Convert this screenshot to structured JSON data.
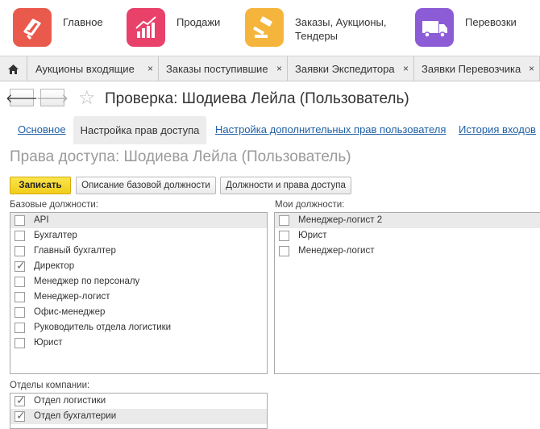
{
  "sections": [
    {
      "label": "Главное",
      "color": "#ea5a4c",
      "icon": "main-icon"
    },
    {
      "label": "Продажи",
      "color": "#e8416a",
      "icon": "sales-chart-icon"
    },
    {
      "label": "Заказы,  Аукционы, Тендеры",
      "color": "#f5b53c",
      "icon": "auction-gavel-icon"
    },
    {
      "label": "Перевозки",
      "color": "#8c5bd6",
      "icon": "truck-icon"
    }
  ],
  "tabs": [
    {
      "label": "Аукционы входящие"
    },
    {
      "label": "Заказы поступившие"
    },
    {
      "label": "Заявки Экспедитора"
    },
    {
      "label": "Заявки Перевозчика"
    }
  ],
  "close_glyph": "×",
  "nav": {
    "back": "🡐",
    "forward": "🡒"
  },
  "form": {
    "title": "Проверка: Шодиева Лейла (Пользователь)",
    "links": [
      {
        "label": "Основное"
      },
      {
        "label": "Настройка прав доступа"
      },
      {
        "label": "Настройка дополнительных прав пользователя"
      },
      {
        "label": "История входов"
      }
    ],
    "subtitle": "Права доступа: Шодиева Лейла (Пользователь)"
  },
  "buttons": {
    "save": "Записать",
    "base_description": "Описание базовой должности",
    "positions_rights": "Должности и права доступа"
  },
  "base_positions": {
    "caption": "Базовые должности:",
    "items": [
      {
        "label": "API",
        "checked": false,
        "selected": true
      },
      {
        "label": "Бухгалтер",
        "checked": false,
        "selected": false
      },
      {
        "label": "Главный бухгалтер",
        "checked": false,
        "selected": false
      },
      {
        "label": "Директор",
        "checked": true,
        "selected": false
      },
      {
        "label": "Менеджер по персоналу",
        "checked": false,
        "selected": false
      },
      {
        "label": "Менеджер-логист",
        "checked": false,
        "selected": false
      },
      {
        "label": "Офис-менеджер",
        "checked": false,
        "selected": false
      },
      {
        "label": "Руководитель отдела логистики",
        "checked": false,
        "selected": false
      },
      {
        "label": "Юрист",
        "checked": false,
        "selected": false
      }
    ]
  },
  "my_positions": {
    "caption": "Мои должности:",
    "items": [
      {
        "label": "Менеджер-логист 2",
        "checked": false,
        "selected": true
      },
      {
        "label": "Юрист",
        "checked": false,
        "selected": false
      },
      {
        "label": "Менеджер-логист",
        "checked": false,
        "selected": false
      }
    ]
  },
  "departments": {
    "caption": "Отделы компании:",
    "items": [
      {
        "label": "Отдел логистики",
        "checked": true,
        "selected": false
      },
      {
        "label": "Отдел бухгалтерии",
        "checked": true,
        "selected": true
      }
    ]
  }
}
